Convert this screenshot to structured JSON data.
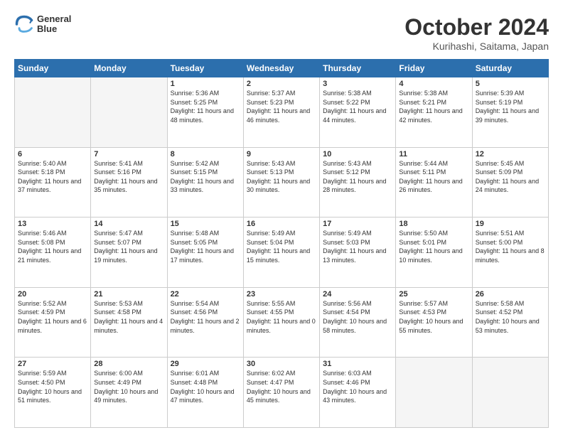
{
  "header": {
    "logo_line1": "General",
    "logo_line2": "Blue",
    "title": "October 2024",
    "subtitle": "Kurihashi, Saitama, Japan"
  },
  "columns": [
    "Sunday",
    "Monday",
    "Tuesday",
    "Wednesday",
    "Thursday",
    "Friday",
    "Saturday"
  ],
  "weeks": [
    [
      {
        "day": "",
        "empty": true
      },
      {
        "day": "",
        "empty": true
      },
      {
        "day": "1",
        "sunrise": "5:36 AM",
        "sunset": "5:25 PM",
        "daylight": "11 hours and 48 minutes."
      },
      {
        "day": "2",
        "sunrise": "5:37 AM",
        "sunset": "5:23 PM",
        "daylight": "11 hours and 46 minutes."
      },
      {
        "day": "3",
        "sunrise": "5:38 AM",
        "sunset": "5:22 PM",
        "daylight": "11 hours and 44 minutes."
      },
      {
        "day": "4",
        "sunrise": "5:38 AM",
        "sunset": "5:21 PM",
        "daylight": "11 hours and 42 minutes."
      },
      {
        "day": "5",
        "sunrise": "5:39 AM",
        "sunset": "5:19 PM",
        "daylight": "11 hours and 39 minutes."
      }
    ],
    [
      {
        "day": "6",
        "sunrise": "5:40 AM",
        "sunset": "5:18 PM",
        "daylight": "11 hours and 37 minutes."
      },
      {
        "day": "7",
        "sunrise": "5:41 AM",
        "sunset": "5:16 PM",
        "daylight": "11 hours and 35 minutes."
      },
      {
        "day": "8",
        "sunrise": "5:42 AM",
        "sunset": "5:15 PM",
        "daylight": "11 hours and 33 minutes."
      },
      {
        "day": "9",
        "sunrise": "5:43 AM",
        "sunset": "5:13 PM",
        "daylight": "11 hours and 30 minutes."
      },
      {
        "day": "10",
        "sunrise": "5:43 AM",
        "sunset": "5:12 PM",
        "daylight": "11 hours and 28 minutes."
      },
      {
        "day": "11",
        "sunrise": "5:44 AM",
        "sunset": "5:11 PM",
        "daylight": "11 hours and 26 minutes."
      },
      {
        "day": "12",
        "sunrise": "5:45 AM",
        "sunset": "5:09 PM",
        "daylight": "11 hours and 24 minutes."
      }
    ],
    [
      {
        "day": "13",
        "sunrise": "5:46 AM",
        "sunset": "5:08 PM",
        "daylight": "11 hours and 21 minutes."
      },
      {
        "day": "14",
        "sunrise": "5:47 AM",
        "sunset": "5:07 PM",
        "daylight": "11 hours and 19 minutes."
      },
      {
        "day": "15",
        "sunrise": "5:48 AM",
        "sunset": "5:05 PM",
        "daylight": "11 hours and 17 minutes."
      },
      {
        "day": "16",
        "sunrise": "5:49 AM",
        "sunset": "5:04 PM",
        "daylight": "11 hours and 15 minutes."
      },
      {
        "day": "17",
        "sunrise": "5:49 AM",
        "sunset": "5:03 PM",
        "daylight": "11 hours and 13 minutes."
      },
      {
        "day": "18",
        "sunrise": "5:50 AM",
        "sunset": "5:01 PM",
        "daylight": "11 hours and 10 minutes."
      },
      {
        "day": "19",
        "sunrise": "5:51 AM",
        "sunset": "5:00 PM",
        "daylight": "11 hours and 8 minutes."
      }
    ],
    [
      {
        "day": "20",
        "sunrise": "5:52 AM",
        "sunset": "4:59 PM",
        "daylight": "11 hours and 6 minutes."
      },
      {
        "day": "21",
        "sunrise": "5:53 AM",
        "sunset": "4:58 PM",
        "daylight": "11 hours and 4 minutes."
      },
      {
        "day": "22",
        "sunrise": "5:54 AM",
        "sunset": "4:56 PM",
        "daylight": "11 hours and 2 minutes."
      },
      {
        "day": "23",
        "sunrise": "5:55 AM",
        "sunset": "4:55 PM",
        "daylight": "11 hours and 0 minutes."
      },
      {
        "day": "24",
        "sunrise": "5:56 AM",
        "sunset": "4:54 PM",
        "daylight": "10 hours and 58 minutes."
      },
      {
        "day": "25",
        "sunrise": "5:57 AM",
        "sunset": "4:53 PM",
        "daylight": "10 hours and 55 minutes."
      },
      {
        "day": "26",
        "sunrise": "5:58 AM",
        "sunset": "4:52 PM",
        "daylight": "10 hours and 53 minutes."
      }
    ],
    [
      {
        "day": "27",
        "sunrise": "5:59 AM",
        "sunset": "4:50 PM",
        "daylight": "10 hours and 51 minutes."
      },
      {
        "day": "28",
        "sunrise": "6:00 AM",
        "sunset": "4:49 PM",
        "daylight": "10 hours and 49 minutes."
      },
      {
        "day": "29",
        "sunrise": "6:01 AM",
        "sunset": "4:48 PM",
        "daylight": "10 hours and 47 minutes."
      },
      {
        "day": "30",
        "sunrise": "6:02 AM",
        "sunset": "4:47 PM",
        "daylight": "10 hours and 45 minutes."
      },
      {
        "day": "31",
        "sunrise": "6:03 AM",
        "sunset": "4:46 PM",
        "daylight": "10 hours and 43 minutes."
      },
      {
        "day": "",
        "empty": true
      },
      {
        "day": "",
        "empty": true
      }
    ]
  ]
}
